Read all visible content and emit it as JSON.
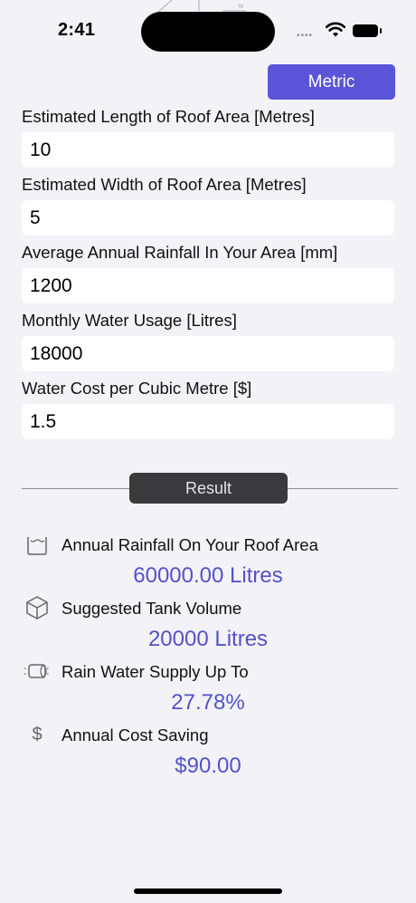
{
  "status": {
    "time": "2:41"
  },
  "header": {
    "unit_toggle": "Metric"
  },
  "fields": [
    {
      "label": "Estimated Length of Roof Area [Metres]",
      "value": "10"
    },
    {
      "label": "Estimated Width of Roof Area [Metres]",
      "value": "5"
    },
    {
      "label": "Average Annual Rainfall In Your Area [mm]",
      "value": "1200"
    },
    {
      "label": "Monthly Water Usage [Litres]",
      "value": "18000"
    },
    {
      "label": "Water Cost per Cubic Metre [$]",
      "value": "1.5"
    }
  ],
  "result_button": "Result",
  "results": [
    {
      "icon": "container-icon",
      "label": "Annual Rainfall On Your Roof Area",
      "value": "60000.00 Litres"
    },
    {
      "icon": "cube-icon",
      "label": "Suggested Tank Volume",
      "value": "20000 Litres"
    },
    {
      "icon": "tank-icon",
      "label": "Rain Water Supply Up To",
      "value": "27.78%"
    },
    {
      "icon": "dollar-icon",
      "label": "Annual Cost Saving",
      "value": "$90.00"
    }
  ],
  "colors": {
    "accent": "#5A55D8",
    "value_text": "#5552C8",
    "background": "#F2F2F7",
    "result_button": "#3A3A3C"
  }
}
